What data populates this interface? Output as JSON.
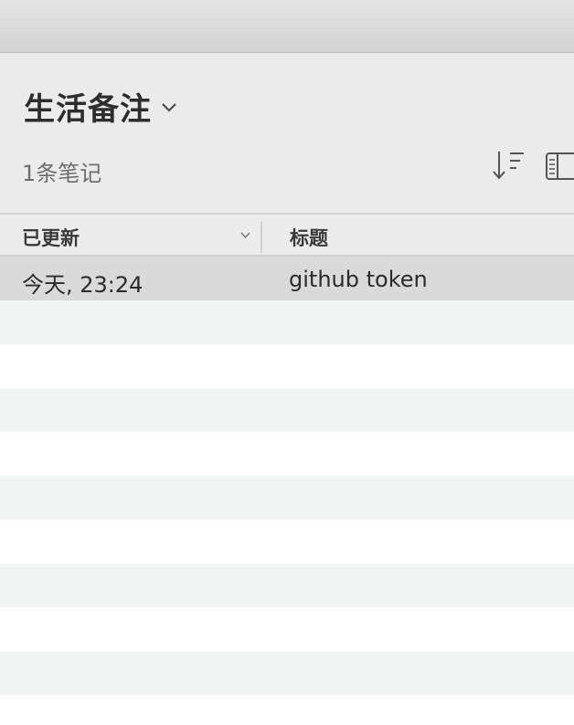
{
  "notebook": {
    "name": "生活备注",
    "note_count": "1条笔记"
  },
  "icons": {
    "title_chevron": "chevron-down-icon",
    "sort": "sort-descending-icon",
    "view": "list-view-icon",
    "column_sort": "chevron-down-icon"
  },
  "columns": {
    "updated": "已更新",
    "title": "标题"
  },
  "notes": [
    {
      "updated": "今天, 23:24",
      "title": "github token",
      "selected": true
    }
  ],
  "colors": {
    "header_background": "#ebebeb",
    "selected_row": "#dadada",
    "striped_row": "#f2f4f4"
  }
}
